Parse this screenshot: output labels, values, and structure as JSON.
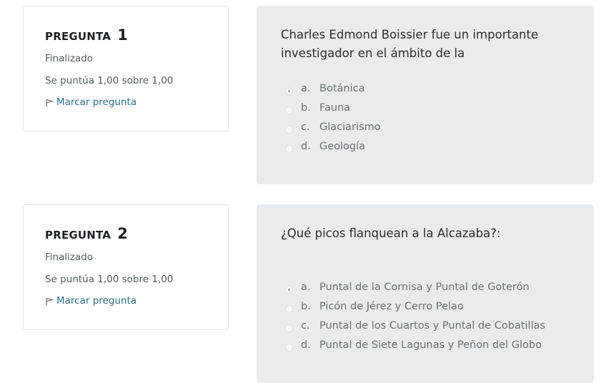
{
  "questions": [
    {
      "label": "PREGUNTA",
      "number": "1",
      "state": "Finalizado",
      "grade": "Se puntúa 1,00 sobre 1,00",
      "flag_label": "Marcar pregunta",
      "text": "Charles Edmond Boissier fue un importante investigador en el ámbito de la",
      "answers": [
        {
          "letter": "a.",
          "text": "Botánica",
          "selected": true
        },
        {
          "letter": "b.",
          "text": "Fauna",
          "selected": false
        },
        {
          "letter": "c.",
          "text": "Glaciarismo",
          "selected": false
        },
        {
          "letter": "d.",
          "text": "Geología",
          "selected": false
        }
      ]
    },
    {
      "label": "PREGUNTA",
      "number": "2",
      "state": "Finalizado",
      "grade": "Se puntúa 1,00 sobre 1,00",
      "flag_label": "Marcar pregunta",
      "text": "¿Qué picos flanquean a la Alcazaba?:",
      "answers": [
        {
          "letter": "a.",
          "text": "Puntal de la Cornisa y Puntal de Goterón",
          "selected": true
        },
        {
          "letter": "b.",
          "text": "Picón de Jérez y Cerro Pelao",
          "selected": false
        },
        {
          "letter": "c.",
          "text": "Puntal de los Cuartos y Puntal de Cobatillas",
          "selected": false
        },
        {
          "letter": "d.",
          "text": "Puntal de Siete Lagunas y Peñon del Globo",
          "selected": false
        }
      ]
    }
  ],
  "icons": {
    "flag": "flag-icon",
    "radio": "radio-icon"
  },
  "colors": {
    "link": "#2c6e8a",
    "content_bg": "#e9ebee"
  }
}
